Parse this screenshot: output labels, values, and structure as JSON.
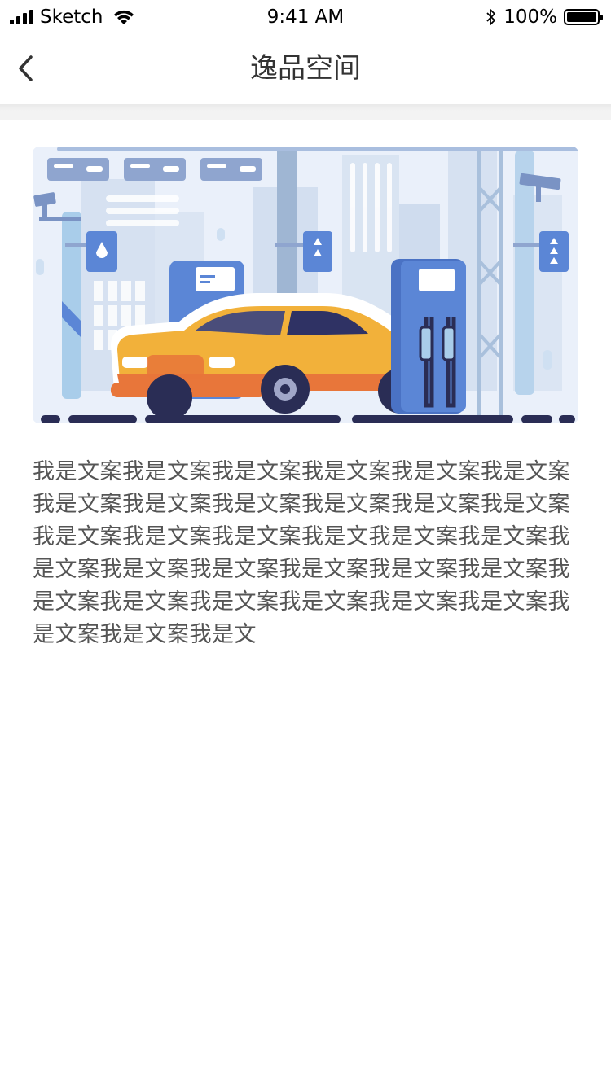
{
  "status_bar": {
    "carrier": "Sketch",
    "time": "9:41 AM",
    "battery_percent": "100%",
    "signal_bars": 4,
    "battery_level": 1.0
  },
  "nav": {
    "title": "逸品空间",
    "back_icon": "chevron-left-icon"
  },
  "banner": {
    "illustration": "car-at-fuel-station",
    "colors": {
      "sky": "#e8eef9",
      "building": "#d3dff0",
      "car_body": "#f2b13a",
      "car_bumper": "#e8763a",
      "pump": "#5b86d6",
      "dark": "#2a2d55"
    }
  },
  "content": {
    "text": "我是文案我是文案我是文案我是文案我是文案我是文案我是文案我是文案我是文案我是文案我是文案我是文案我是文案我是文案我是文案我是文我是文案我是文案我是文案我是文案我是文案我是文案我是文案我是文案我是文案我是文案我是文案我是文案我是文案我是文案我是文案我是文案我是文"
  }
}
